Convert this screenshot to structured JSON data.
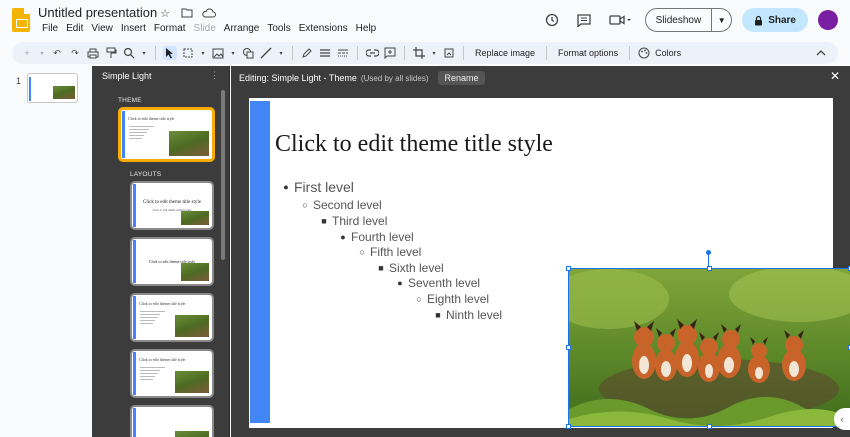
{
  "app": {
    "title": "Untitled presentation",
    "menu": [
      "File",
      "Edit",
      "View",
      "Insert",
      "Format",
      "Slide",
      "Arrange",
      "Tools",
      "Extensions",
      "Help"
    ],
    "menu_disabled": [
      "Slide"
    ]
  },
  "header": {
    "slideshow_label": "Slideshow",
    "share_label": "Share"
  },
  "toolbar": {
    "replace_image": "Replace image",
    "format_options": "Format options",
    "colors": "Colors"
  },
  "filmstrip": {
    "slide_number": "1"
  },
  "theme_panel": {
    "title": "Simple Light",
    "theme_label": "THEME",
    "layouts_label": "LAYOUTS",
    "thumb_title_text": "Click to edit theme title style",
    "layout_title_text": "Click to edit theme title style",
    "layout_sub_text": "Click to edit theme subtitle style"
  },
  "editor": {
    "editing_label": "Editing: Simple Light - Theme",
    "used_label": "(Used by all slides)",
    "rename_label": "Rename",
    "slide_title": "Click to edit theme title style",
    "levels": [
      {
        "label": "First level",
        "bullet": "●"
      },
      {
        "label": "Second level",
        "bullet": "○"
      },
      {
        "label": "Third level",
        "bullet": "■"
      },
      {
        "label": "Fourth level",
        "bullet": "●"
      },
      {
        "label": "Fifth level",
        "bullet": "○"
      },
      {
        "label": "Sixth level",
        "bullet": "■"
      },
      {
        "label": "Seventh level",
        "bullet": "●"
      },
      {
        "label": "Eighth level",
        "bullet": "○"
      },
      {
        "label": "Ninth level",
        "bullet": "■"
      }
    ]
  },
  "colors": {
    "accent": "#4285f4",
    "selection": "#1a73e8",
    "share_bg": "#c2e7ff",
    "panel_bg": "#3c3c3c",
    "theme_selected": "#f9ab00"
  }
}
